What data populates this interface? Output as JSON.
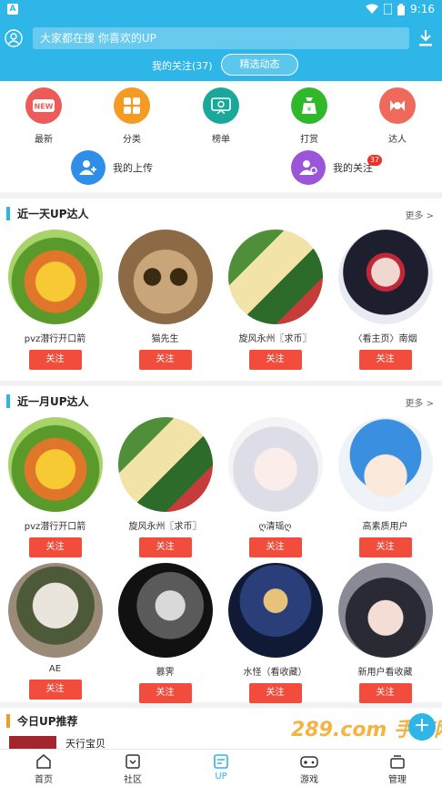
{
  "status": {
    "app_glyph": "A",
    "time": "9:16"
  },
  "header": {
    "search_placeholder": "大家都在搜  你喜欢的UP",
    "follow_count": "我的关注(37)",
    "featured_label": "精选动态"
  },
  "quicknav": {
    "items": [
      {
        "label": "最新",
        "icon": "new-icon",
        "color": "#ee5a5a"
      },
      {
        "label": "分类",
        "icon": "grid-icon",
        "color": "#f59a23"
      },
      {
        "label": "榜单",
        "icon": "ranking-icon",
        "color": "#1aa89a"
      },
      {
        "label": "打赏",
        "icon": "reward-icon",
        "color": "#2fb82a"
      },
      {
        "label": "达人",
        "icon": "expert-icon",
        "color": "#ef6a5a"
      }
    ],
    "row2": [
      {
        "label": "我的上传",
        "icon": "upload-user-icon",
        "color": "#2f8fe8"
      },
      {
        "label": "我的关注",
        "icon": "follow-user-icon",
        "color": "#9b55d8",
        "badge": "37"
      }
    ]
  },
  "sections": [
    {
      "title": "近一天UP达人",
      "more": "更多 >",
      "users": [
        {
          "name": "pvz潜行开口箭",
          "follow": "关注"
        },
        {
          "name": "猫先生",
          "follow": "关注"
        },
        {
          "name": "旋风永州〖求币〗",
          "follow": "关注"
        },
        {
          "name": "〈看主页〉南烟",
          "follow": "关注"
        }
      ]
    },
    {
      "title": "近一月UP达人",
      "more": "更多 >",
      "users": [
        {
          "name": "pvz潜行开口箭",
          "follow": "关注"
        },
        {
          "name": "旋风永州〖求币〗",
          "follow": "关注"
        },
        {
          "name": "ღ清瑶ღ",
          "follow": "关注"
        },
        {
          "name": "高素质用户",
          "follow": "关注"
        },
        {
          "name": "AE",
          "follow": "关注"
        },
        {
          "name": "慕霁",
          "follow": "关注"
        },
        {
          "name": "水怪（看收藏）",
          "follow": "关注"
        },
        {
          "name": "新用户看收藏",
          "follow": "关注"
        }
      ]
    }
  ],
  "today": {
    "title": "今日UP推荐",
    "item": "天行宝贝",
    "watermark": "289.com 手游网"
  },
  "bottomnav": [
    {
      "label": "首页",
      "icon": "home-icon"
    },
    {
      "label": "社区",
      "icon": "community-icon"
    },
    {
      "label": "UP",
      "icon": "up-icon",
      "active": true
    },
    {
      "label": "游戏",
      "icon": "gamepad-icon"
    },
    {
      "label": "管理",
      "icon": "manage-icon"
    }
  ],
  "colors": {
    "brand": "#2fb6e8",
    "follow_button": "#f24c3d"
  }
}
